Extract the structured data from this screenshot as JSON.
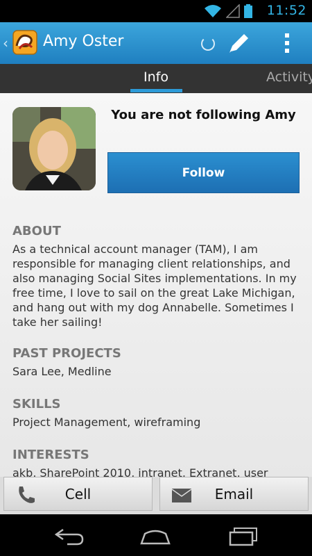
{
  "status_bar": {
    "time": "11:52",
    "accent": "#33b5e5"
  },
  "action_bar": {
    "title": "Amy Oster",
    "icons": [
      "back-chevron-icon",
      "app-icon",
      "refresh-spinner-icon",
      "edit-pencil-icon",
      "overflow-menu-icon"
    ]
  },
  "tabs": [
    {
      "label": "Info",
      "selected": true
    },
    {
      "label": "Activity",
      "selected": false
    }
  ],
  "profile": {
    "follow_status": "You are not following Amy",
    "follow_button": "Follow"
  },
  "sections": [
    {
      "heading": "ABOUT",
      "body": "As a technical account manager (TAM), I am responsible for managing client relationships, and also managing Social Sites implementations. In my free time, I love to sail on the great Lake Michigan, and hang out with my dog Annabelle. Sometimes I take her sailing!"
    },
    {
      "heading": "PAST PROJECTS",
      "body": "Sara Lee, Medline"
    },
    {
      "heading": "SKILLS",
      "body": "Project Management, wireframing"
    },
    {
      "heading": "INTERESTS",
      "body": "akb, SharePoint 2010, intranet, Extranet, user"
    }
  ],
  "bottom_buttons": {
    "cell": "Cell",
    "email": "Email"
  },
  "nav_icons": [
    "back-icon",
    "home-icon",
    "recent-apps-icon"
  ]
}
